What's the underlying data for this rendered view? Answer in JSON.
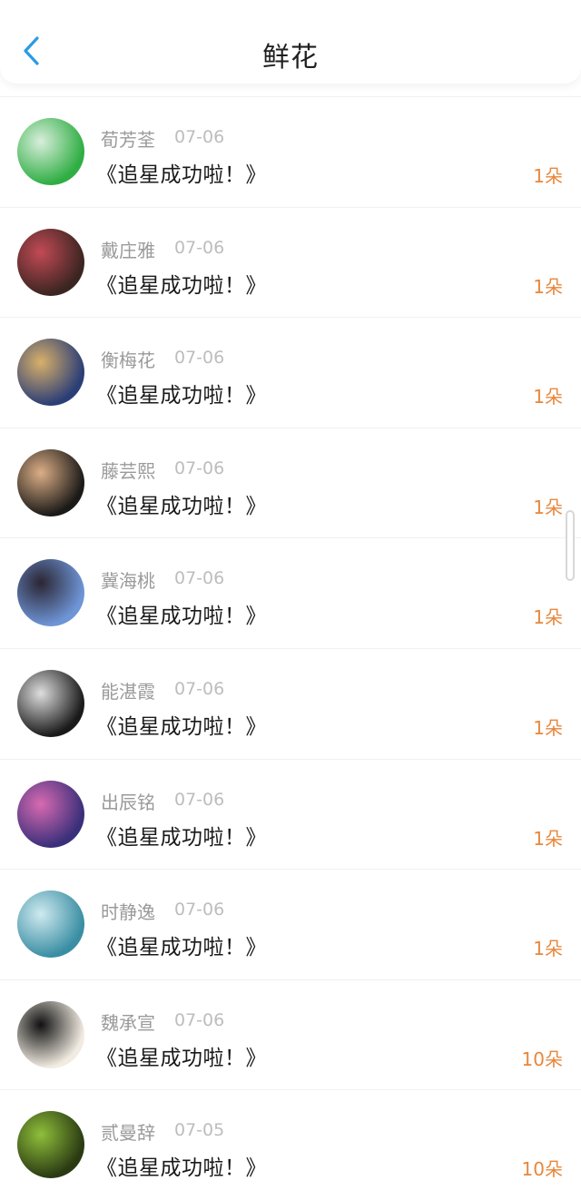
{
  "header": {
    "title": "鲜花",
    "back_icon": "chevron-left-icon",
    "accent": "#2a9be4"
  },
  "rows": [
    {
      "name": "荀芳荃",
      "date": "07-06",
      "message": "《追星成功啦！》",
      "count": "1朵",
      "avatar_colors": [
        "#2fae43",
        "#d9eedc"
      ]
    },
    {
      "name": "戴庄雅",
      "date": "07-06",
      "message": "《追星成功啦！》",
      "count": "1朵",
      "avatar_colors": [
        "#3b2521",
        "#c24a55"
      ]
    },
    {
      "name": "衡梅花",
      "date": "07-06",
      "message": "《追星成功啦！》",
      "count": "1朵",
      "avatar_colors": [
        "#2b3e76",
        "#d9b06a"
      ]
    },
    {
      "name": "藤芸熙",
      "date": "07-06",
      "message": "《追星成功啦！》",
      "count": "1朵",
      "avatar_colors": [
        "#1b1a18",
        "#dcae86"
      ]
    },
    {
      "name": "冀海桃",
      "date": "07-06",
      "message": "《追星成功啦！》",
      "count": "1朵",
      "avatar_colors": [
        "#6e95d6",
        "#2b2533"
      ]
    },
    {
      "name": "能湛霞",
      "date": "07-06",
      "message": "《追星成功啦！》",
      "count": "1朵",
      "avatar_colors": [
        "#1a1a1a",
        "#dedede"
      ]
    },
    {
      "name": "出辰铭",
      "date": "07-06",
      "message": "《追星成功啦！》",
      "count": "1朵",
      "avatar_colors": [
        "#3a2f7a",
        "#d76ab1"
      ]
    },
    {
      "name": "时静逸",
      "date": "07-06",
      "message": "《追星成功啦！》",
      "count": "1朵",
      "avatar_colors": [
        "#3a8ea3",
        "#cfeaf0"
      ]
    },
    {
      "name": "魏承宣",
      "date": "07-06",
      "message": "《追星成功啦！》",
      "count": "10朵",
      "avatar_colors": [
        "#f1ebe1",
        "#111111"
      ]
    },
    {
      "name": "贰曼辞",
      "date": "07-05",
      "message": "《追星成功啦！》",
      "count": "10朵",
      "avatar_colors": [
        "#2a3a13",
        "#8fbf3a"
      ]
    }
  ],
  "colors": {
    "count": "#e8873b",
    "name": "#9a9a9a",
    "date": "#bdbdbd"
  }
}
